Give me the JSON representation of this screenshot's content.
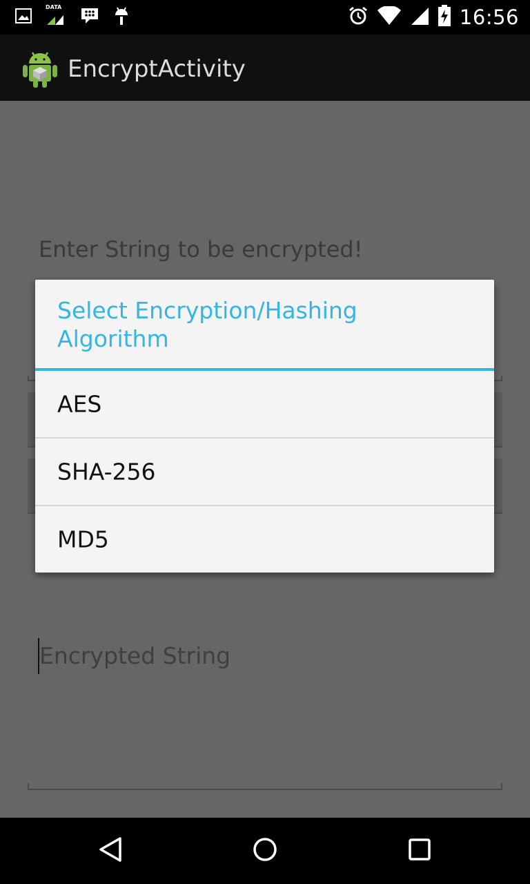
{
  "status_bar": {
    "time": "16:56",
    "data_label": "DATA",
    "icons": [
      "image-icon",
      "data-signal-icon",
      "bbm-icon",
      "android-debug-icon",
      "alarm-icon",
      "wifi-icon",
      "cell-signal-icon",
      "battery-charging-icon"
    ]
  },
  "action_bar": {
    "title": "EncryptActivity",
    "icon": "android-app-icon"
  },
  "main": {
    "prompt_label": "Enter String to be encrypted!",
    "output_placeholder": "Encrypted String"
  },
  "dialog": {
    "title": "Select Encryption/Hashing Algorithm",
    "options": [
      {
        "label": "AES"
      },
      {
        "label": "SHA-256"
      },
      {
        "label": "MD5"
      }
    ],
    "accent_color": "#33b5e5"
  },
  "nav_bar": {
    "icons": [
      "back-icon",
      "home-icon",
      "recents-icon"
    ]
  }
}
